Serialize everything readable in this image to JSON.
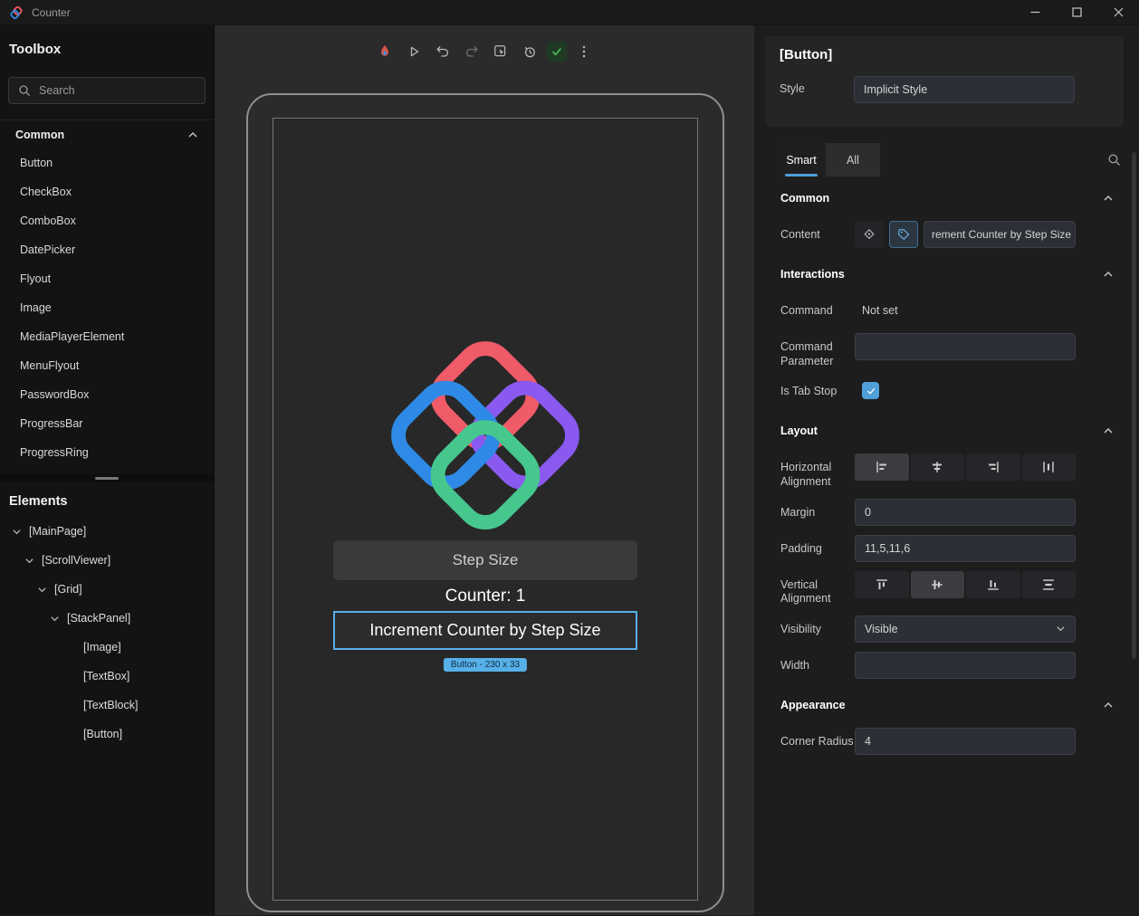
{
  "window": {
    "title": "Counter"
  },
  "toolbox": {
    "title": "Toolbox",
    "search_placeholder": "Search",
    "section_label": "Common",
    "items": [
      "Button",
      "CheckBox",
      "ComboBox",
      "DatePicker",
      "Flyout",
      "Image",
      "MediaPlayerElement",
      "MenuFlyout",
      "PasswordBox",
      "ProgressBar",
      "ProgressRing"
    ]
  },
  "elements": {
    "title": "Elements",
    "tree": [
      {
        "label": "[MainPage]"
      },
      {
        "label": "[ScrollViewer]"
      },
      {
        "label": "[Grid]"
      },
      {
        "label": "[StackPanel]"
      },
      {
        "label": "[Image]"
      },
      {
        "label": "[TextBox]"
      },
      {
        "label": "[TextBlock]"
      },
      {
        "label": "[Button]"
      }
    ]
  },
  "canvas": {
    "device_app": {
      "textbox_placeholder": "Step Size",
      "counter_text": "Counter: 1",
      "button_label": "Increment Counter by Step Size"
    },
    "selection_badge": "Button - 230 x 33"
  },
  "properties": {
    "selected_element": "[Button]",
    "style": {
      "label": "Style",
      "value": "Implicit Style"
    },
    "tabs": {
      "smart": "Smart",
      "all": "All",
      "active": "Smart"
    },
    "common": {
      "title": "Common",
      "content": {
        "label": "Content",
        "value": "rement Counter by Step Size"
      }
    },
    "interactions": {
      "title": "Interactions",
      "command": {
        "label": "Command",
        "value": "Not set"
      },
      "command_parameter": {
        "label": "Command Parameter",
        "value": ""
      },
      "is_tab_stop": {
        "label": "Is Tab Stop",
        "checked": true
      }
    },
    "layout": {
      "title": "Layout",
      "horizontal_alignment": {
        "label": "Horizontal Alignment",
        "value": "Left"
      },
      "margin": {
        "label": "Margin",
        "value": "0"
      },
      "padding": {
        "label": "Padding",
        "value": "11,5,11,6"
      },
      "vertical_alignment": {
        "label": "Vertical Alignment",
        "value": "Center"
      },
      "visibility": {
        "label": "Visibility",
        "value": "Visible"
      },
      "width": {
        "label": "Width",
        "value": ""
      }
    },
    "appearance": {
      "title": "Appearance",
      "corner_radius": {
        "label": "Corner Radius",
        "value": "4"
      }
    }
  },
  "colors": {
    "accent": "#57b0e8",
    "success": "#4cc15a",
    "logo_pink": "#ef5b67",
    "logo_blue": "#2e8ae6",
    "logo_purple": "#8959f0",
    "logo_green": "#46c78e"
  },
  "icons": {
    "app-logo": "interlocked-diamonds",
    "search": "magnifier",
    "chevron-up": "^",
    "chevron-down": "v",
    "hot-reload": "flame",
    "play": "triangle",
    "undo": "arrow-left-curve",
    "redo": "arrow-right-curve",
    "element-picker": "rect-cursor",
    "history": "clock",
    "diagnostics": "check",
    "more-options": "kebab",
    "binding": "diamond-node",
    "tag": "tag",
    "minimize": "line",
    "maximize": "square",
    "close": "x"
  }
}
